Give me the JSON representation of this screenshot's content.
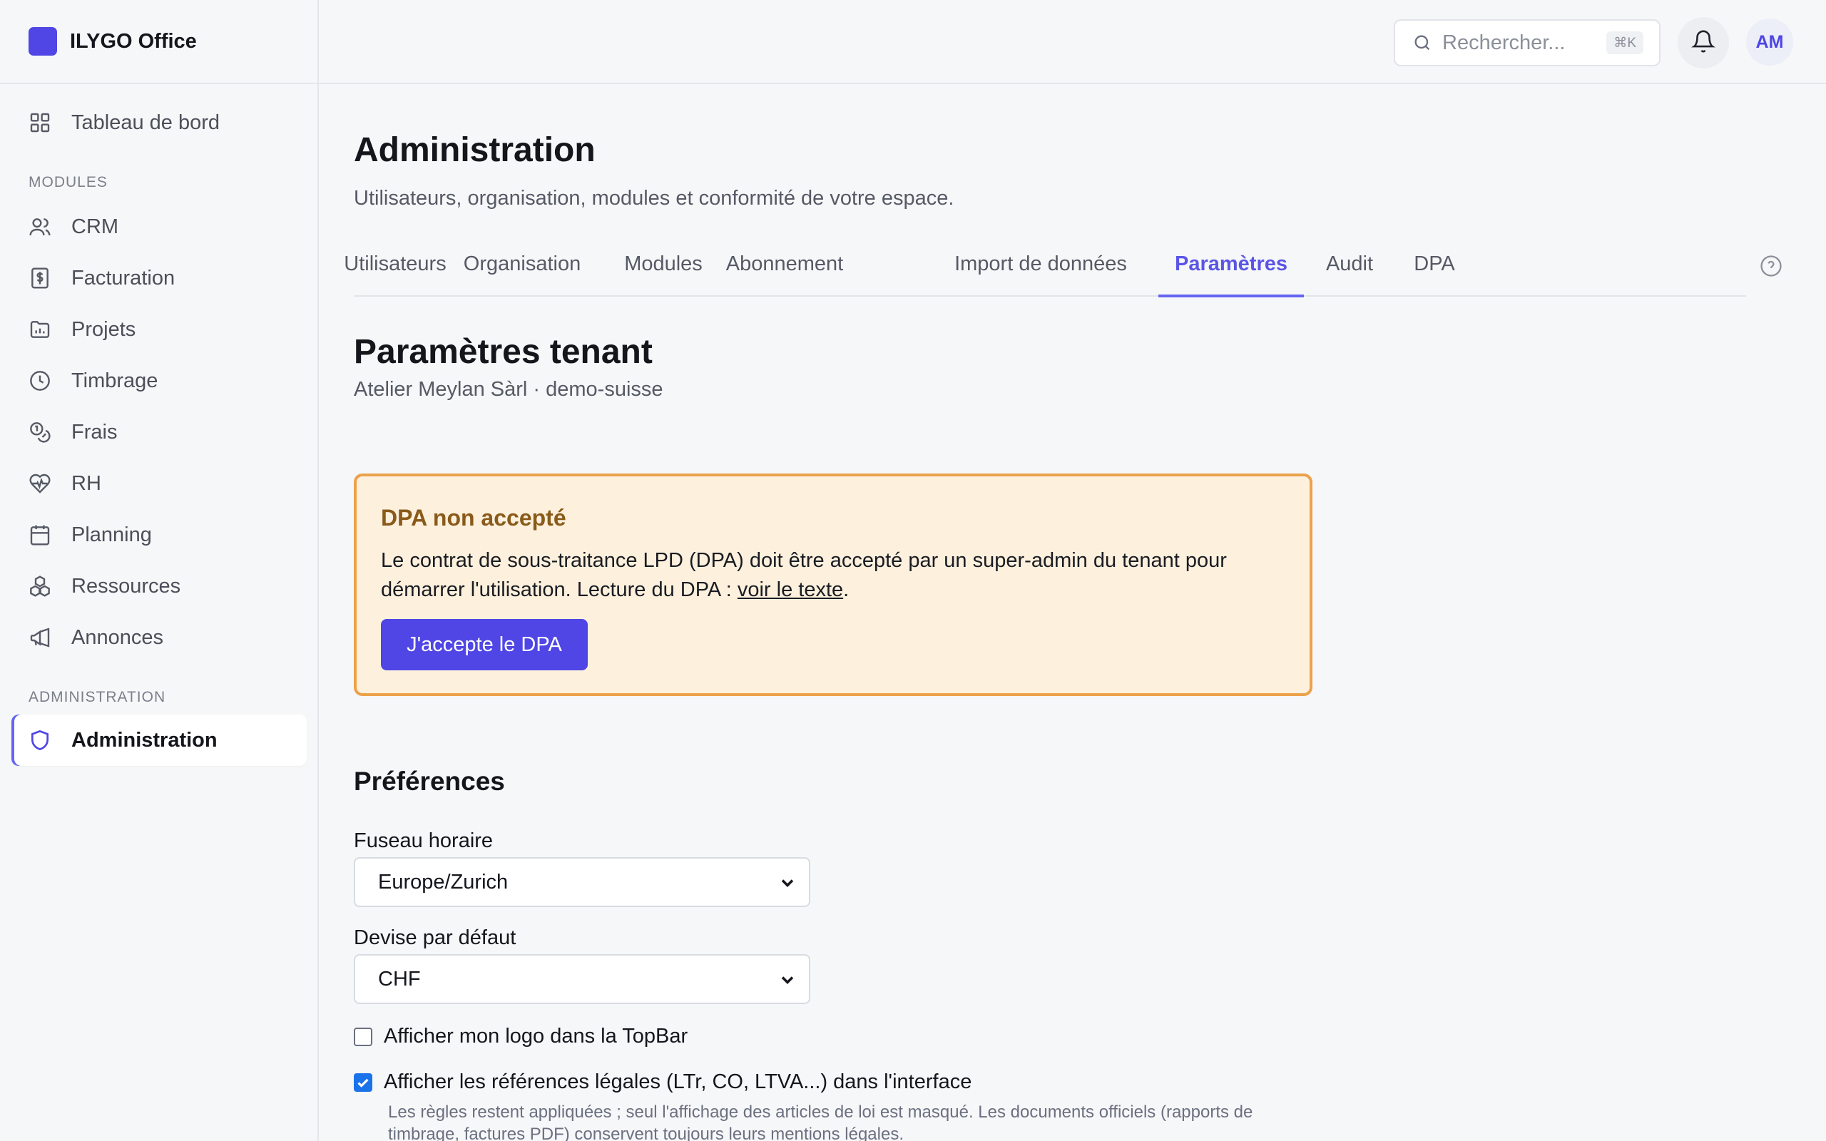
{
  "app": {
    "name": "ILYGO Office"
  },
  "sidebar": {
    "dashboard": "Tableau de bord",
    "modules_label": "MODULES",
    "modules": [
      {
        "label": "CRM",
        "icon": "users-icon"
      },
      {
        "label": "Facturation",
        "icon": "invoice-icon"
      },
      {
        "label": "Projets",
        "icon": "folder-chart-icon"
      },
      {
        "label": "Timbrage",
        "icon": "clock-icon"
      },
      {
        "label": "Frais",
        "icon": "coins-icon"
      },
      {
        "label": "RH",
        "icon": "heart-pulse-icon"
      },
      {
        "label": "Planning",
        "icon": "calendar-icon"
      },
      {
        "label": "Ressources",
        "icon": "boxes-icon"
      },
      {
        "label": "Annonces",
        "icon": "megaphone-icon"
      }
    ],
    "admin_label": "ADMINISTRATION",
    "admin_item": "Administration"
  },
  "topbar": {
    "search_placeholder": "Rechercher...",
    "shortcut": "⌘K",
    "avatar_initials": "AM"
  },
  "page": {
    "title": "Administration",
    "subtitle": "Utilisateurs, organisation, modules et conformité de votre espace."
  },
  "tabs": [
    "Utilisateurs",
    "Organisation",
    "Modules",
    "Abonnement",
    "Import de données",
    "Paramètres",
    "Audit",
    "DPA"
  ],
  "active_tab": "Paramètres",
  "section": {
    "title": "Paramètres tenant",
    "subtitle": "Atelier Meylan Sàrl · demo-suisse"
  },
  "alert": {
    "title": "DPA non accepté",
    "text_before": "Le contrat de sous-traitance LPD (DPA) doit être accepté par un super-admin du tenant pour démarrer l'utilisation. Lecture du DPA : ",
    "link": "voir le texte",
    "text_after": ".",
    "button": "J'accepte le DPA"
  },
  "preferences": {
    "title": "Préférences",
    "timezone_label": "Fuseau horaire",
    "timezone_value": "Europe/Zurich",
    "currency_label": "Devise par défaut",
    "currency_value": "CHF",
    "logo_label": "Afficher mon logo dans la TopBar",
    "logo_checked": false,
    "legal_label": "Afficher les références légales (LTr, CO, LTVA...) dans l'interface",
    "legal_checked": true,
    "legal_help": "Les règles restent appliquées ; seul l'affichage des articles de loi est masqué. Les documents officiels (rapports de timbrage, factures PDF) conservent toujours leurs mentions légales."
  },
  "colors": {
    "accent": "#4f46e5",
    "warning_border": "#eba24b",
    "warning_bg": "#fdf1de"
  }
}
